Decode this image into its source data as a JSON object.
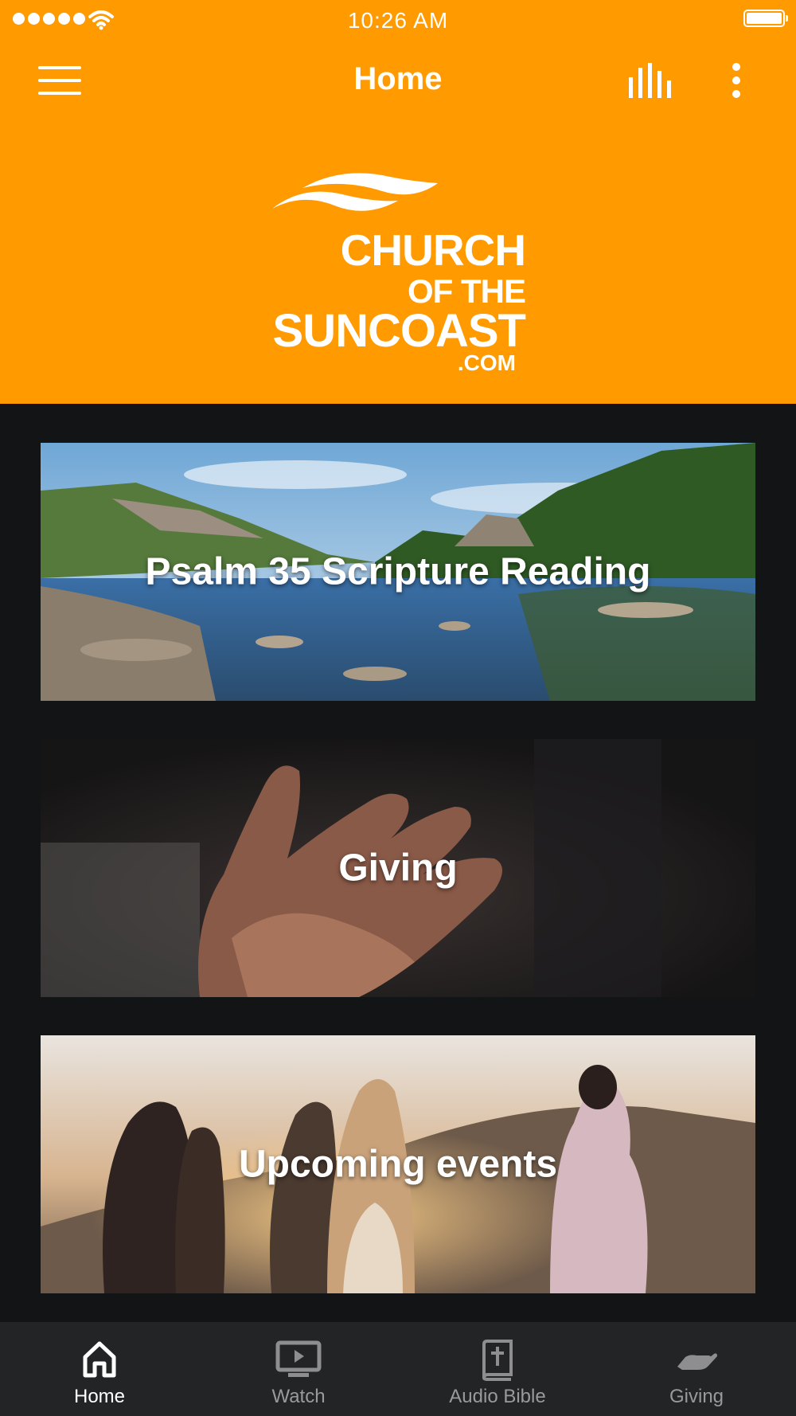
{
  "status_bar": {
    "time": "10:26 AM"
  },
  "nav": {
    "title": "Home"
  },
  "logo": {
    "line1": "CHURCH",
    "line2": "OF THE",
    "line3": "SUNCOAST",
    "line4": ".COM"
  },
  "cards": [
    {
      "title": "Psalm 35 Scripture Reading"
    },
    {
      "title": "Giving"
    },
    {
      "title": "Upcoming events"
    }
  ],
  "tabs": [
    {
      "label": "Home",
      "icon": "home-icon",
      "active": true
    },
    {
      "label": "Watch",
      "icon": "tv-icon",
      "active": false
    },
    {
      "label": "Audio Bible",
      "icon": "bible-icon",
      "active": false
    },
    {
      "label": "Giving",
      "icon": "giving-hand-icon",
      "active": false
    }
  ],
  "colors": {
    "accent": "#FF9A00",
    "background": "#131416",
    "tab_bar": "#232426"
  }
}
